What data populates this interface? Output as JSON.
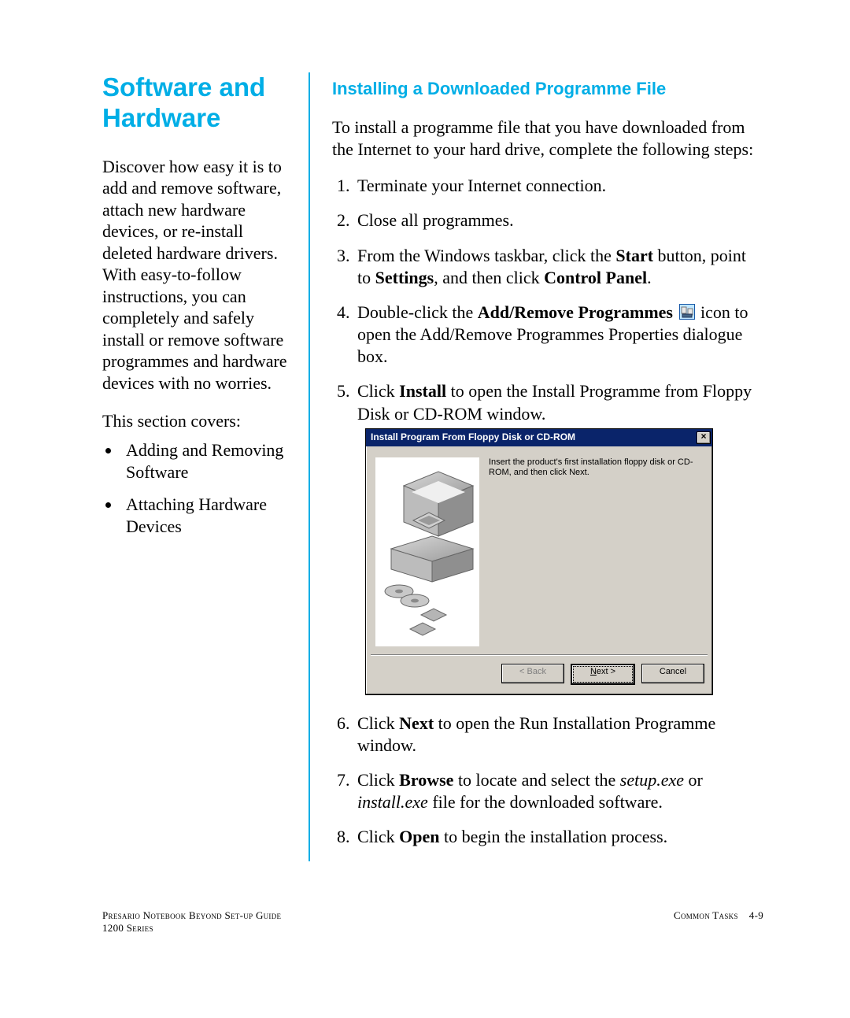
{
  "sidebar": {
    "title": "Software and Hardware",
    "intro": "Discover how easy it is to add and remove software, attach new hardware devices, or re-install deleted hardware drivers. With easy-to-follow instructions, you can completely and safely install or remove software programmes and hardware devices with no worries.",
    "covers_label": "This section covers:",
    "covers": [
      "Adding and Removing Software",
      "Attaching Hardware Devices"
    ]
  },
  "main": {
    "heading": "Installing a Downloaded Programme File",
    "intro": "To install a programme file that you have downloaded from the Internet to your hard drive, complete the following steps:",
    "step1": "Terminate your Internet connection.",
    "step2": "Close all programmes.",
    "step3": {
      "a": "From the Windows taskbar, click the ",
      "b": "Start",
      "c": " button, point to ",
      "d": "Settings",
      "e": ", and then click ",
      "f": "Control Panel",
      "g": "."
    },
    "step4": {
      "a": "Double-click the ",
      "b": "Add/Remove Programmes",
      "c": " icon to  open the Add/Remove Programmes Properties dialogue box."
    },
    "step5": {
      "a": "Click ",
      "b": "Install",
      "c": " to open the Install Programme from Floppy Disk or CD-ROM window."
    },
    "step6": {
      "a": "Click ",
      "b": "Next",
      "c": " to open the Run Installation Programme window."
    },
    "step7": {
      "a": "Click ",
      "b": "Browse",
      "c": " to locate and select the ",
      "d": "setup.exe",
      "e": " or ",
      "f": "install.exe",
      "g": " file for the downloaded software."
    },
    "step8": {
      "a": "Click ",
      "b": "Open",
      "c": " to begin the installation process."
    }
  },
  "dialog": {
    "title": "Install Program From Floppy Disk or CD-ROM",
    "body": "Insert the product's first installation floppy disk or CD-ROM, and then click Next.",
    "back": "< Back",
    "next_underline": "N",
    "next_rest": "ext >",
    "cancel": "Cancel"
  },
  "footer": {
    "left1": "Presario Notebook Beyond Set-up Guide",
    "left2": "1200 Series",
    "right_label": "Common Tasks",
    "page": "4-9"
  }
}
